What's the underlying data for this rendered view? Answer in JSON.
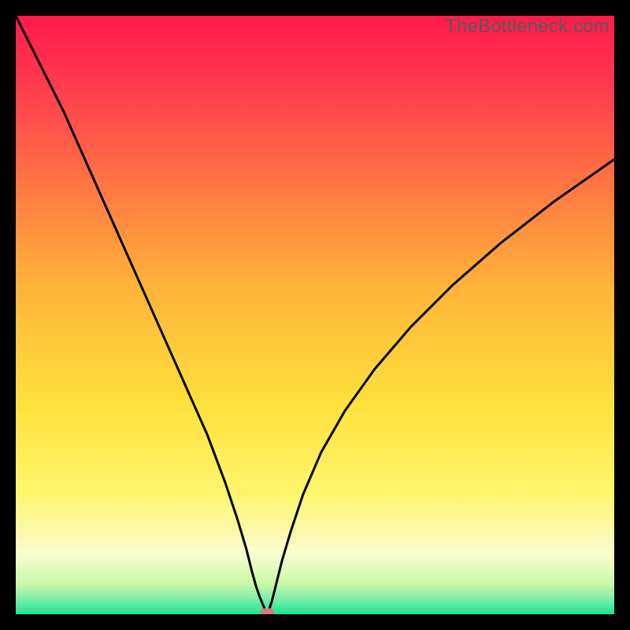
{
  "watermark": "TheBottleneck.com",
  "chart_data": {
    "type": "line",
    "title": "",
    "xlabel": "",
    "ylabel": "",
    "xlim": [
      0,
      100
    ],
    "ylim": [
      0,
      100
    ],
    "grid": false,
    "legend": false,
    "background_gradient": {
      "direction": "vertical",
      "stops": [
        {
          "t": 0.0,
          "color": "#ff1a4a"
        },
        {
          "t": 0.1,
          "color": "#ff3550"
        },
        {
          "t": 0.25,
          "color": "#ff6a45"
        },
        {
          "t": 0.45,
          "color": "#ffb33a"
        },
        {
          "t": 0.65,
          "color": "#ffe13c"
        },
        {
          "t": 0.8,
          "color": "#fff66e"
        },
        {
          "t": 0.9,
          "color": "#fafccf"
        },
        {
          "t": 0.95,
          "color": "#c8f8a8"
        },
        {
          "t": 0.975,
          "color": "#7bedaa"
        },
        {
          "t": 1.0,
          "color": "#18e68f"
        }
      ]
    },
    "marker": {
      "x": 42,
      "y": 0,
      "color": "#d87a78",
      "rx": 9,
      "ry": 6
    },
    "series": [
      {
        "name": "bottleneck-curve",
        "color": "#000000",
        "width": 3,
        "x": [
          0,
          4,
          8,
          12,
          16,
          20,
          24,
          28,
          32,
          35,
          37,
          38.5,
          39.5,
          40.2,
          40.8,
          41.3,
          41.7,
          42,
          42.3,
          42.8,
          43.5,
          44.5,
          46,
          48,
          51,
          55,
          60,
          66,
          73,
          81,
          90,
          100
        ],
        "y": [
          100,
          92,
          84,
          75,
          66,
          57,
          48,
          39,
          30,
          22,
          16,
          11,
          7,
          4.5,
          2.8,
          1.6,
          0.7,
          0.2,
          0.7,
          2.2,
          5,
          9,
          14,
          20,
          27,
          34,
          41,
          48,
          55,
          62,
          69,
          76
        ]
      }
    ]
  }
}
